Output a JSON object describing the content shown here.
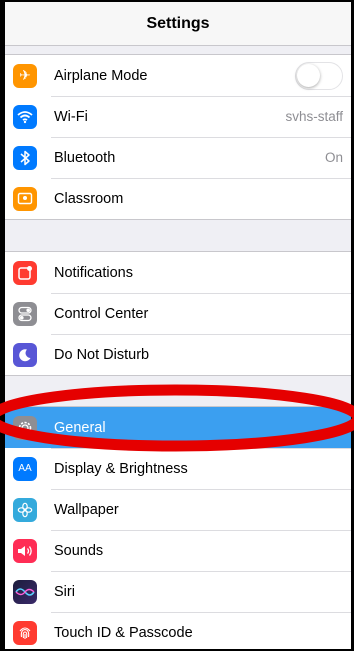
{
  "header": {
    "title": "Settings"
  },
  "groups": [
    {
      "items": [
        {
          "label": "Airplane Mode",
          "icon": "airplane-icon",
          "color": "#ff9500",
          "control": "toggle",
          "toggle_on": false
        },
        {
          "label": "Wi-Fi",
          "icon": "wifi-icon",
          "color": "#007aff",
          "value": "svhs-staff"
        },
        {
          "label": "Bluetooth",
          "icon": "bluetooth-icon",
          "color": "#007aff",
          "value": "On"
        },
        {
          "label": "Classroom",
          "icon": "classroom-icon",
          "color": "#ff9500"
        }
      ]
    },
    {
      "items": [
        {
          "label": "Notifications",
          "icon": "notifications-icon",
          "color": "#ff3b30"
        },
        {
          "label": "Control Center",
          "icon": "control-center-icon",
          "color": "#8e8e93"
        },
        {
          "label": "Do Not Disturb",
          "icon": "moon-icon",
          "color": "#5856d6"
        }
      ]
    },
    {
      "items": [
        {
          "label": "General",
          "icon": "gear-icon",
          "color": "#8e8e93",
          "selected": true
        },
        {
          "label": "Display & Brightness",
          "icon": "display-brightness-icon",
          "color": "#007aff"
        },
        {
          "label": "Wallpaper",
          "icon": "wallpaper-icon",
          "color": "#34aadc"
        },
        {
          "label": "Sounds",
          "icon": "speaker-icon",
          "color": "#ff2d55"
        },
        {
          "label": "Siri",
          "icon": "siri-icon",
          "color": "#222222"
        },
        {
          "label": "Touch ID & Passcode",
          "icon": "fingerprint-icon",
          "color": "#ff3b30"
        }
      ]
    }
  ],
  "colors": {
    "selection": "#3b9ff0",
    "annotation": "#e50000"
  }
}
